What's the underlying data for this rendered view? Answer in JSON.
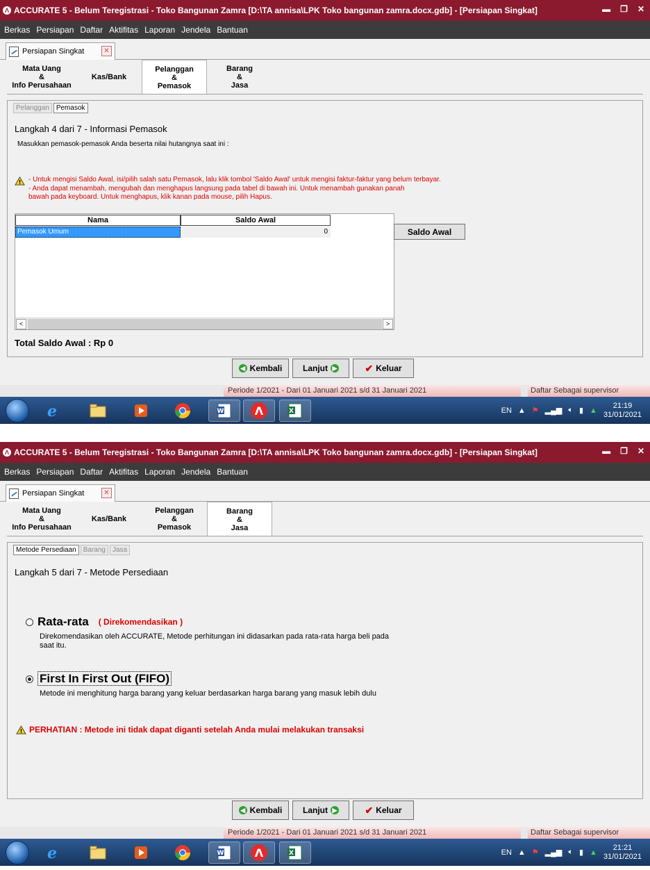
{
  "screens": [
    {
      "titlebar": {
        "title": "ACCURATE 5  - Belum Teregistrasi - Toko Bangunan Zamra  [D:\\TA annisa\\LPK Toko bangunan zamra.docx.gdb] - [Persiapan Singkat]"
      },
      "menu": [
        "Berkas",
        "Persiapan",
        "Daftar",
        "Aktifitas",
        "Laporan",
        "Jendela",
        "Bantuan"
      ],
      "doc_tab": "Persiapan Singkat",
      "steps": [
        "Mata Uang\n&\nInfo Perusahaan",
        "Kas/Bank",
        "Pelanggan\n&\nPemasok",
        "Barang\n&\nJasa"
      ],
      "active_step": 2,
      "subtabs": [
        "Pelanggan",
        "Pemasok"
      ],
      "active_subtab": 1,
      "step_title": "Langkah 4 dari 7   - Informasi Pemasok",
      "intro": "Masukkan pemasok-pemasok Anda beserta nilai hutangnya saat ini :",
      "warn_lines": [
        "-  Untuk mengisi Saldo Awal, isi/pilih salah satu Pemasok, lalu klik tombol 'Saldo Awal' untuk mengisi faktur-faktur yang belum terbayar.",
        "-  Anda dapat menambah, mengubah dan menghapus langsung pada tabel di bawah ini. Untuk menambah gunakan panah",
        "   bawah pada keyboard. Untuk menghapus, klik kanan pada mouse, pilih Hapus."
      ],
      "grid": {
        "columns": [
          "Nama",
          "Saldo Awal"
        ],
        "rows": [
          {
            "nama": "Pemasok Umum",
            "saldo": "0"
          }
        ]
      },
      "saldo_button": "Saldo Awal",
      "total": "Total Saldo Awal : Rp 0",
      "nav": {
        "back": "Kembali",
        "next": "Lanjut",
        "exit": "Keluar"
      },
      "status": {
        "period": "Periode 1/2021 - Dari 01 Januari 2021 s/d 31 Januari 2021",
        "user": "Daftar Sebagai supervisor"
      },
      "tray": {
        "lang": "EN",
        "time": "21:19",
        "date": "31/01/2021"
      }
    },
    {
      "titlebar": {
        "title": "ACCURATE 5  - Belum Teregistrasi - Toko Bangunan Zamra  [D:\\TA annisa\\LPK Toko bangunan zamra.docx.gdb] - [Persiapan Singkat]"
      },
      "menu": [
        "Berkas",
        "Persiapan",
        "Daftar",
        "Aktifitas",
        "Laporan",
        "Jendela",
        "Bantuan"
      ],
      "doc_tab": "Persiapan Singkat",
      "steps": [
        "Mata Uang\n&\nInfo Perusahaan",
        "Kas/Bank",
        "Pelanggan\n&\nPemasok",
        "Barang\n&\nJasa"
      ],
      "active_step": 3,
      "subtabs": [
        "Metode Persediaan",
        "Barang",
        "Jasa"
      ],
      "active_subtab": 0,
      "step_title": "Langkah 5 dari 7   - Metode Persediaan",
      "options": [
        {
          "label": "Rata-rata",
          "recommend": "( Direkomendasikan )",
          "desc": "Direkomendasikan oleh ACCURATE, Metode perhitungan ini didasarkan pada rata-rata harga beli pada saat itu.",
          "checked": false
        },
        {
          "label": "First In First Out (FIFO)",
          "recommend": "",
          "desc": "Metode ini menghitung harga barang yang keluar berdasarkan harga barang yang masuk lebih dulu",
          "checked": true
        }
      ],
      "warning": "PERHATIAN : Metode ini tidak dapat diganti setelah Anda mulai melakukan transaksi",
      "nav": {
        "back": "Kembali",
        "next": "Lanjut",
        "exit": "Keluar"
      },
      "status": {
        "period": "Periode 1/2021 - Dari 01 Januari 2021 s/d 31 Januari 2021",
        "user": "Daftar Sebagai supervisor"
      },
      "tray": {
        "lang": "EN",
        "time": "21:21",
        "date": "31/01/2021"
      }
    }
  ],
  "icons": [
    "app-logo-icon",
    "page-icon",
    "close-icon",
    "warning-icon",
    "back-arrow-icon",
    "next-arrow-icon",
    "check-icon",
    "start-orb-icon",
    "ie-icon",
    "folder-icon",
    "media-icon",
    "chrome-icon",
    "word-icon",
    "accurate-icon",
    "excel-icon",
    "flag-icon",
    "signal-icon",
    "volume-icon",
    "power-icon",
    "network-icon"
  ],
  "colors": {
    "titlebar": "#8b1a2f",
    "menubar": "#3c3c3c",
    "selection": "#3399ff",
    "warning_text": "#e00000",
    "taskbar": "#1f4678"
  }
}
